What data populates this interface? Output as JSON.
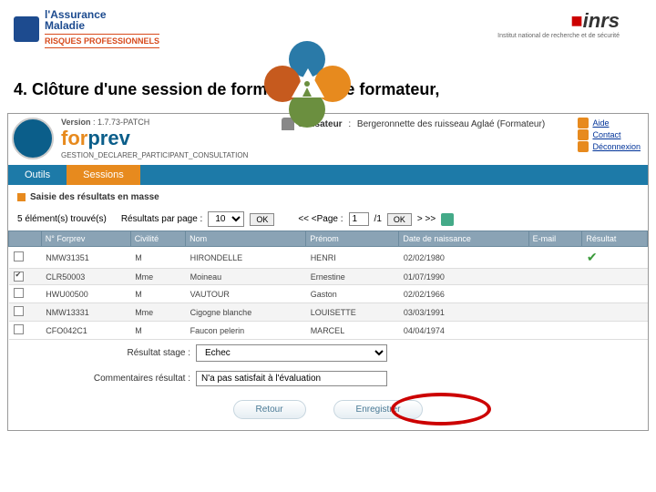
{
  "logos": {
    "am_line1": "l'Assurance",
    "am_line2": "Maladie",
    "am_sub": "Risques Professionnels",
    "inrs": "inrs",
    "inrs_sub": "Institut national de recherche et de sécurité"
  },
  "heading": "4.  Clôture d'une session de formation par le formateur,",
  "app": {
    "version_label": "Version",
    "version_value": "1.7.73-PATCH",
    "brand_for": "for",
    "brand_prev": "prev",
    "breadcrumb": "GESTION_DECLARER_PARTICIPANT_CONSULTATION",
    "user_label": "Utilisateur",
    "user_value": "Bergeronnette des ruisseau Aglaé (Formateur)",
    "links": {
      "aide": "Aide",
      "contact": "Contact",
      "deconnexion": "Déconnexion"
    }
  },
  "tabs": {
    "outils": "Outils",
    "sessions": "Sessions"
  },
  "mass": "Saisie des résultats en masse",
  "controls": {
    "count": "5 élément(s) trouvé(s)",
    "per_page_label": "Résultats par page :",
    "per_page_value": "10",
    "ok": "OK",
    "pager_prev": "<< <Page :",
    "pager_value": "1",
    "pager_total": "/1",
    "pager_next": "> >>"
  },
  "table": {
    "headers": [
      "",
      "N° Forprev",
      "Civilité",
      "Nom",
      "Prénom",
      "Date de naissance",
      "E-mail",
      "Résultat"
    ],
    "rows": [
      {
        "checked": false,
        "num": "NMW31351",
        "civ": "M",
        "nom": "HIRONDELLE",
        "prenom": "HENRI",
        "dob": "02/02/1980",
        "email": "",
        "ok": true
      },
      {
        "checked": true,
        "num": "CLR50003",
        "civ": "Mme",
        "nom": "Moineau",
        "prenom": "Ernestine",
        "dob": "01/07/1990",
        "email": "",
        "ok": false
      },
      {
        "checked": false,
        "num": "HWU00500",
        "civ": "M",
        "nom": "VAUTOUR",
        "prenom": "Gaston",
        "dob": "02/02/1966",
        "email": "",
        "ok": false
      },
      {
        "checked": false,
        "num": "NMW13331",
        "civ": "Mme",
        "nom": "Cigogne blanche",
        "prenom": "LOUISETTE",
        "dob": "03/03/1991",
        "email": "",
        "ok": false
      },
      {
        "checked": false,
        "num": "CFO042C1",
        "civ": "M",
        "nom": "Faucon pelerin",
        "prenom": "MARCEL",
        "dob": "04/04/1974",
        "email": "",
        "ok": false
      }
    ]
  },
  "form": {
    "resultat_label": "Résultat stage  :",
    "resultat_value": "Echec",
    "comment_label": "Commentaires résultat  :",
    "comment_value": "N'a pas satisfait à l'évaluation"
  },
  "buttons": {
    "retour": "Retour",
    "enregistrer": "Enregistrer"
  }
}
